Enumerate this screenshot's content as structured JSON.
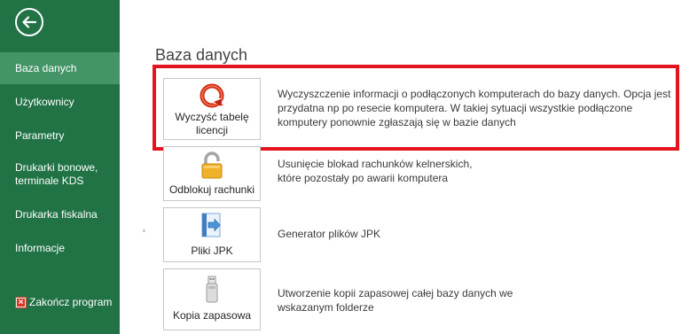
{
  "sidebar": {
    "items": [
      {
        "label": "Baza danych",
        "active": true
      },
      {
        "label": "Użytkownicy"
      },
      {
        "label": "Parametry"
      },
      {
        "label": "Drukarki bonowe, terminale KDS"
      },
      {
        "label": "Drukarka fiskalna"
      },
      {
        "label": "Informacje"
      }
    ],
    "exit_label": "Zakończ program"
  },
  "main": {
    "title": "Baza danych",
    "tiles": [
      {
        "label": "Wyczyść tabelę licencji",
        "icon": "refresh-red-icon",
        "description": "Wyczyszczenie informacji o podłączonych komputerach do bazy danych. Opcja jest przydatna np po resecie komputera. W takiej sytuacji wszystkie podłączone komputery ponownie zgłaszają się w bazie danych"
      },
      {
        "label": "Odblokuj rachunki",
        "icon": "padlock-icon",
        "description": "Usunięcie blokad rachunków kelnerskich, które pozostały po awarii komputera"
      },
      {
        "label": "Pliki JPK",
        "icon": "export-arrow-icon",
        "description": "Generator plików JPK"
      },
      {
        "label": "Kopia zapasowa",
        "icon": "usb-drive-icon",
        "description": "Utworzenie kopii zapasowej całej bazy danych we wskazanym folderze"
      }
    ]
  },
  "colors": {
    "sidebar_bg": "#217346",
    "sidebar_active": "#439467",
    "highlight": "#e3141e"
  }
}
